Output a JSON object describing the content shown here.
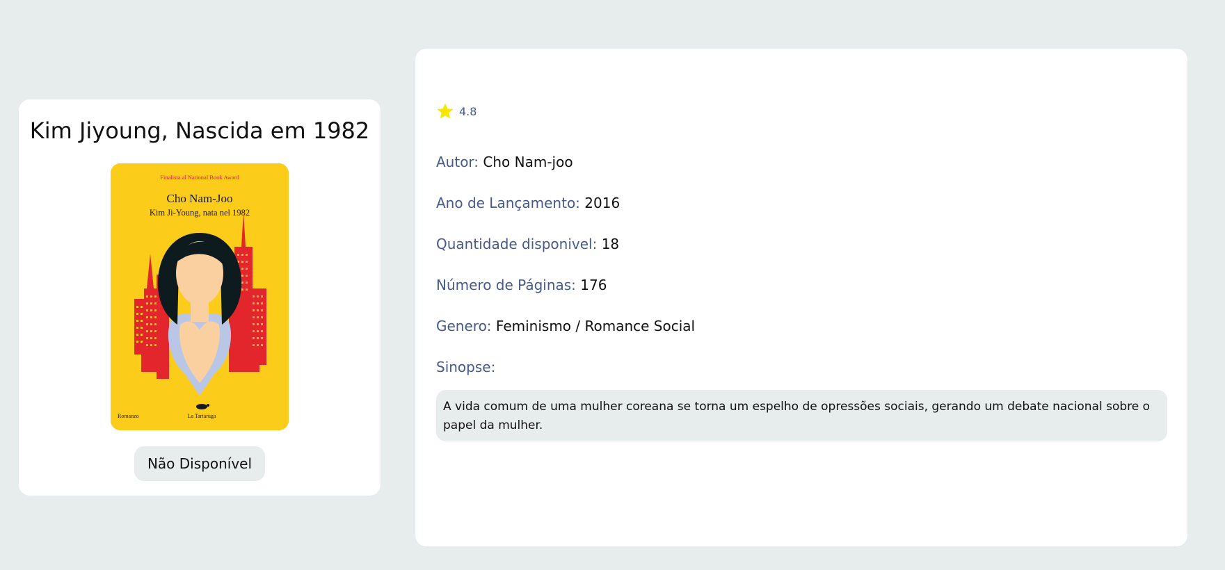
{
  "book": {
    "title": "Kim Jiyoung, Nascida em 1982",
    "availability_button": "Não Disponível",
    "cover": {
      "top_line": "Finalista al National Book Award",
      "author": "Cho Nam-Joo",
      "subtitle": "Kim Ji-Young, nata nel 1982",
      "genre_label": "Romanzo",
      "publisher": "La Tartaruga"
    }
  },
  "details": {
    "rating": "4.8",
    "fields": [
      {
        "label": "Autor:",
        "value": "Cho Nam-joo"
      },
      {
        "label": "Ano de Lançamento:",
        "value": "2016"
      },
      {
        "label": "Quantidade disponivel:",
        "value": "18"
      },
      {
        "label": "Número de Páginas:",
        "value": "176"
      },
      {
        "label": "Genero:",
        "value": "Feminismo / Romance Social"
      },
      {
        "label": "Sinopse:",
        "value": ""
      }
    ],
    "synopsis": "A vida comum de uma mulher coreana se torna um espelho de opressões sociais, gerando um debate nacional sobre o papel da mulher."
  },
  "colors": {
    "background": "#e7ecec",
    "card": "#ffffff",
    "label": "#45598a",
    "star": "#f7e600",
    "cover_yellow": "#fbcd1a",
    "cover_red": "#e3262b"
  },
  "icons": {
    "rating": "star-icon"
  }
}
